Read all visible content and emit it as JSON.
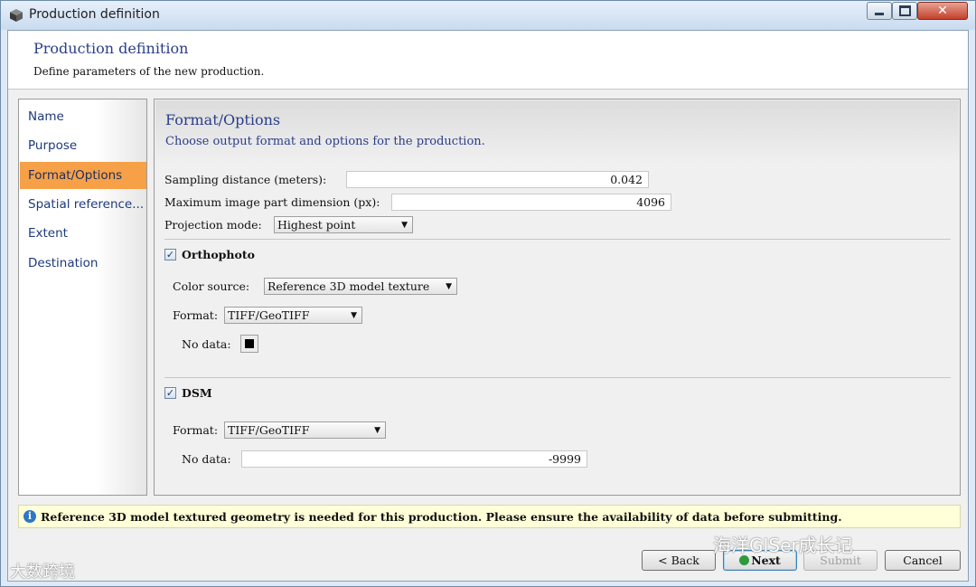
{
  "window": {
    "title": "Production definition"
  },
  "header": {
    "title": "Production definition",
    "subtitle": "Define parameters of the new production."
  },
  "sidebar": {
    "items": [
      {
        "label": "Name"
      },
      {
        "label": "Purpose"
      },
      {
        "label": "Format/Options",
        "active": true
      },
      {
        "label": "Spatial reference..."
      },
      {
        "label": "Extent"
      },
      {
        "label": "Destination"
      }
    ]
  },
  "content": {
    "title": "Format/Options",
    "subtitle": "Choose output format and options for the production.",
    "sampling": {
      "label": "Sampling distance (meters):",
      "value": "0.042"
    },
    "max_dim": {
      "label": "Maximum image part dimension (px):",
      "value": "4096"
    },
    "projection": {
      "label": "Projection mode:",
      "value": "Highest point"
    },
    "orthophoto": {
      "label": "Orthophoto",
      "checked": true,
      "color_source": {
        "label": "Color source:",
        "value": "Reference 3D model texture"
      },
      "format": {
        "label": "Format:",
        "value": "TIFF/GeoTIFF"
      },
      "nodata": {
        "label": "No data:",
        "color": "#000000"
      }
    },
    "dsm": {
      "label": "DSM",
      "checked": true,
      "format": {
        "label": "Format:",
        "value": "TIFF/GeoTIFF"
      },
      "nodata": {
        "label": "No data:",
        "value": "-9999"
      }
    }
  },
  "info": {
    "icon": "info-icon",
    "text": "Reference 3D model textured geometry is needed for this production. Please ensure the availability of data before submitting."
  },
  "buttons": {
    "back": "< Back",
    "next": "Next",
    "submit": "Submit",
    "cancel": "Cancel"
  },
  "watermarks": {
    "left": "大数跨境",
    "right": "海洋GISer成长记"
  },
  "colors": {
    "accent": "#f6a048",
    "title_blue": "#2b3e8a",
    "info_bg": "#ffffd8"
  }
}
